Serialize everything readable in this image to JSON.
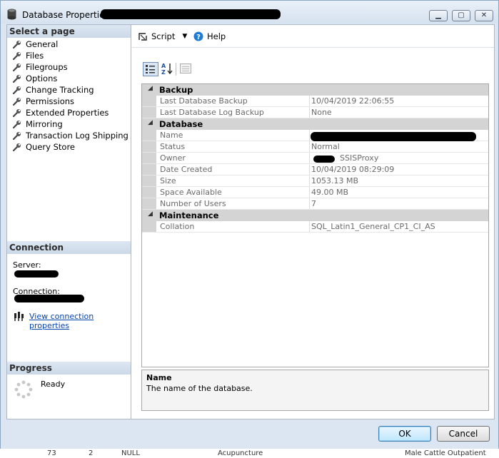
{
  "window": {
    "title": "Database Properties - d",
    "minimize_label": "▁",
    "maximize_label": "▢",
    "close_label": "✕"
  },
  "select_page": {
    "header": "Select a page",
    "items": [
      {
        "label": "General"
      },
      {
        "label": "Files"
      },
      {
        "label": "Filegroups"
      },
      {
        "label": "Options"
      },
      {
        "label": "Change Tracking"
      },
      {
        "label": "Permissions"
      },
      {
        "label": "Extended Properties"
      },
      {
        "label": "Mirroring"
      },
      {
        "label": "Transaction Log Shipping"
      },
      {
        "label": "Query Store"
      }
    ]
  },
  "connection": {
    "header": "Connection",
    "server_label": "Server:",
    "connection_label": "Connection:",
    "view_link": "View connection properties"
  },
  "progress": {
    "header": "Progress",
    "status": "Ready"
  },
  "toolbar": {
    "script_label": "Script",
    "help_label": "Help"
  },
  "properties": {
    "categories": [
      {
        "name": "Backup",
        "rows": [
          {
            "name": "Last Database Backup",
            "value": "10/04/2019 22:06:55"
          },
          {
            "name": "Last Database Log Backup",
            "value": "None"
          }
        ]
      },
      {
        "name": "Database",
        "rows": [
          {
            "name": "Name",
            "value": ""
          },
          {
            "name": "Status",
            "value": "Normal"
          },
          {
            "name": "Owner",
            "value": "SSISProxy"
          },
          {
            "name": "Date Created",
            "value": "10/04/2019 08:29:09"
          },
          {
            "name": "Size",
            "value": "1053.13 MB"
          },
          {
            "name": "Space Available",
            "value": "49.00 MB"
          },
          {
            "name": "Number of Users",
            "value": "7"
          }
        ]
      },
      {
        "name": "Maintenance",
        "rows": [
          {
            "name": "Collation",
            "value": "SQL_Latin1_General_CP1_CI_AS"
          }
        ]
      }
    ]
  },
  "description": {
    "title": "Name",
    "text": "The name of the database."
  },
  "buttons": {
    "ok": "OK",
    "cancel": "Cancel"
  },
  "background_strip": {
    "col1": "73",
    "col2": "2",
    "col3": "NULL",
    "col4": "Acupuncture",
    "col5": "Male Cattle Outpatient"
  },
  "colors": {
    "title_gradient_top": "#e9f0f8",
    "section_header": "#cbd8e7",
    "category_row": "#d4d4d4",
    "link": "#0645ad",
    "ok_button": "#bee6fd"
  }
}
